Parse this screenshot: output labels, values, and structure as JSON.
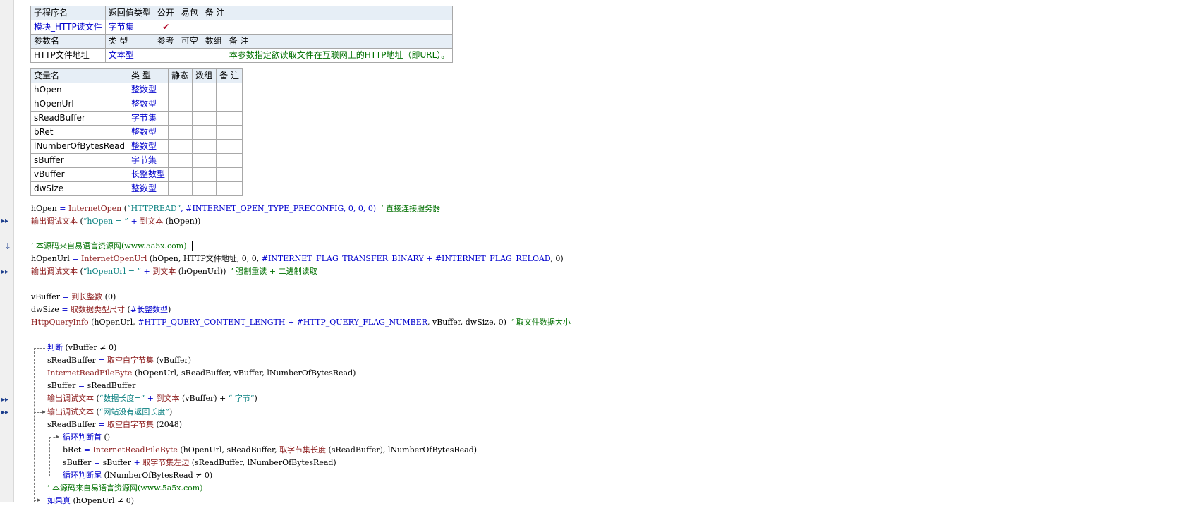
{
  "sub": {
    "headers": [
      "子程序名",
      "返回值类型",
      "公开",
      "易包",
      "备 注"
    ],
    "name": "模块_HTTP读文件",
    "ret_type": "字节集",
    "public_mark": "✔",
    "param_headers": [
      "参数名",
      "类 型",
      "参考",
      "可空",
      "数组",
      "备 注"
    ],
    "param": {
      "name": "HTTP文件地址",
      "type": "文本型",
      "note": "本参数指定欲读取文件在互联网上的HTTP地址（即URL）。"
    }
  },
  "vars": {
    "headers": [
      "变量名",
      "类 型",
      "静态",
      "数组",
      "备 注"
    ],
    "rows": [
      {
        "name": "hOpen",
        "type": "整数型"
      },
      {
        "name": "hOpenUrl",
        "type": "整数型"
      },
      {
        "name": "sReadBuffer",
        "type": "字节集"
      },
      {
        "name": "bRet",
        "type": "整数型"
      },
      {
        "name": "lNumberOfBytesRead",
        "type": "整数型"
      },
      {
        "name": "sBuffer",
        "type": "字节集"
      },
      {
        "name": "vBuffer",
        "type": "长整数型"
      },
      {
        "name": "dwSize",
        "type": "整数型"
      }
    ]
  },
  "code": {
    "l1": {
      "a": "hOpen ",
      "b": "= ",
      "c": "InternetOpen",
      "d": " (",
      "e": "“HTTPREAD”",
      "f": ", #INTERNET_OPEN_TYPE_PRECONFIG, 0, 0, 0)",
      "g": "  ’ 直接连接服务器"
    },
    "l2": {
      "a": "输出调试文本",
      "b": " (",
      "c": "“hOpen = ”",
      "d": " + ",
      "e": "到文本",
      "f": " (hOpen))"
    },
    "l3": {
      "a": "’ 本源码来自易语言资源网(www.5a5x.com)"
    },
    "l4": {
      "a": "hOpenUrl ",
      "b": "= ",
      "c": "InternetOpenUrl",
      "d": " (hOpen, HTTP文件地址, 0, 0, ",
      "e": "#INTERNET_FLAG_TRANSFER_BINARY",
      "f": " + ",
      "g": "#INTERNET_FLAG_RELOAD",
      "h": ", 0)"
    },
    "l5": {
      "a": "输出调试文本",
      "b": " (",
      "c": "“hOpenUrl = ”",
      "d": " + ",
      "e": "到文本",
      "f": " (hOpenUrl))",
      "g": "  ’ 强制重读 + 二进制读取"
    },
    "l6": {
      "a": "vBuffer ",
      "b": "= ",
      "c": "到长整数",
      "d": " (0)"
    },
    "l7": {
      "a": "dwSize ",
      "b": "= ",
      "c": "取数据类型尺寸",
      "d": " (",
      "e": "#长整数型",
      "f": ")"
    },
    "l8": {
      "a": "HttpQueryInfo",
      "b": " (hOpenUrl, ",
      "c": "#HTTP_QUERY_CONTENT_LENGTH",
      "d": " + ",
      "e": "#HTTP_QUERY_FLAG_NUMBER",
      "f": ", vBuffer, dwSize, 0)",
      "g": "  ’ 取文件数据大小"
    },
    "l9": {
      "a": "判断",
      "b": " (vBuffer ≠ 0)"
    },
    "l10": {
      "a": "sReadBuffer ",
      "b": "= ",
      "c": "取空白字节集",
      "d": " (vBuffer)"
    },
    "l11": {
      "a": "InternetReadFileByte",
      "b": " (hOpenUrl, sReadBuffer, vBuffer, lNumberOfBytesRead)"
    },
    "l12": {
      "a": "sBuffer ",
      "b": "= ",
      "c": "sReadBuffer"
    },
    "l13": {
      "a": "输出调试文本",
      "b": " (",
      "c": "“数据长度=”",
      "d": " + ",
      "e": "到文本",
      "f": " (vBuffer) + ",
      "g": "“ 字节”",
      "h": ")"
    },
    "l14": {
      "a": "输出调试文本",
      "b": " (",
      "c": "“网站没有返回长度”",
      "d": ")"
    },
    "l15": {
      "a": "sReadBuffer ",
      "b": "= ",
      "c": "取空白字节集",
      "d": " (2048)"
    },
    "l16": {
      "a": "循环判断首",
      "b": " ()"
    },
    "l17": {
      "a": "bRet ",
      "b": "= ",
      "c": "InternetReadFileByte",
      "d": " (hOpenUrl, sReadBuffer, ",
      "e": "取字节集长度",
      "f": " (sReadBuffer), lNumberOfBytesRead)"
    },
    "l18": {
      "a": "sBuffer ",
      "b": "= ",
      "c": "sBuffer ",
      "d": "+ ",
      "e": "取字节集左边",
      "f": " (sReadBuffer, lNumberOfBytesRead)"
    },
    "l19": {
      "a": "循环判断尾",
      "b": " (lNumberOfBytesRead ≠ 0)"
    },
    "l20": {
      "a": "’ 本源码来自易语言资源网(www.5a5x.com)"
    },
    "l21": {
      "a": "如果真",
      "b": " (hOpenUrl ≠ 0)"
    }
  },
  "gutter": {
    "debug_mark": "▸▸",
    "breakpoint_mark": "↓"
  },
  "colors": {
    "keyword": "#0000cc",
    "function": "#8b1a1a",
    "string": "#0a8080",
    "comment": "#007000",
    "header_bg": "#e6eef6"
  }
}
